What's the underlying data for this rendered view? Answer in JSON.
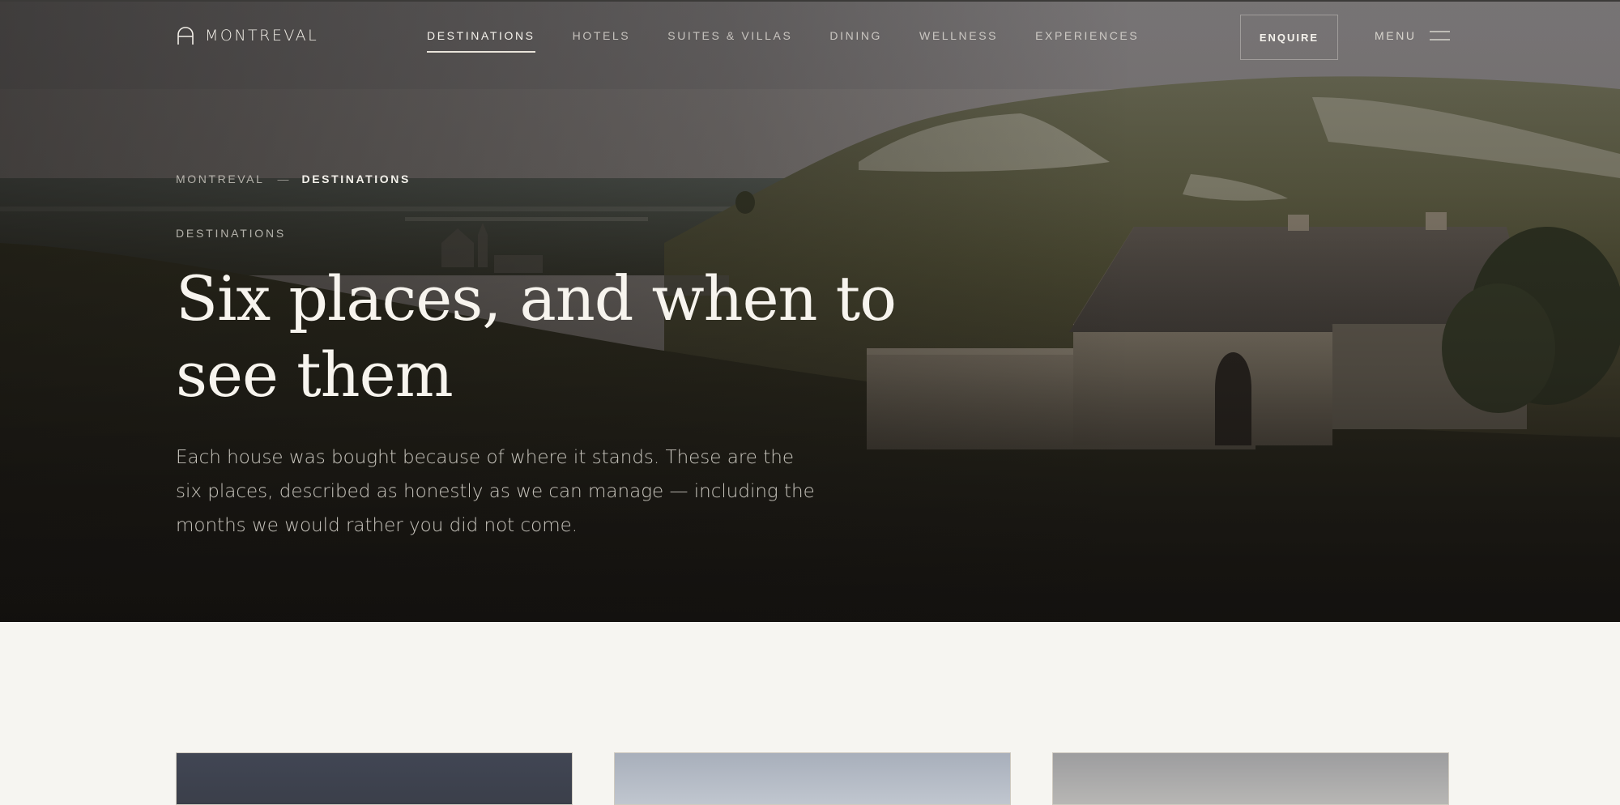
{
  "brand": {
    "name": "MONTREVAL",
    "icon": "arch-icon"
  },
  "nav": {
    "links": [
      {
        "label": "DESTINATIONS",
        "active": true
      },
      {
        "label": "HOTELS",
        "active": false
      },
      {
        "label": "SUITES & VILLAS",
        "active": false
      },
      {
        "label": "DINING",
        "active": false
      },
      {
        "label": "WELLNESS",
        "active": false
      },
      {
        "label": "EXPERIENCES",
        "active": false
      }
    ],
    "enquire_label": "ENQUIRE",
    "menu_label": "MENU",
    "menu_icon": "hamburger-icon"
  },
  "hero": {
    "breadcrumb": {
      "home": "MONTREVAL",
      "separator": "—",
      "current": "DESTINATIONS"
    },
    "eyebrow": "DESTINATIONS",
    "title": "Six places, and when to see them",
    "lead": "Each house was bought because of where it stands. These are the six places, described as honestly as we can manage — including the months we would rather you did not come."
  },
  "colors": {
    "page_background": "#f6f5f1",
    "hero_text": "#f7f4ee",
    "card_border": "#cfcac0"
  }
}
